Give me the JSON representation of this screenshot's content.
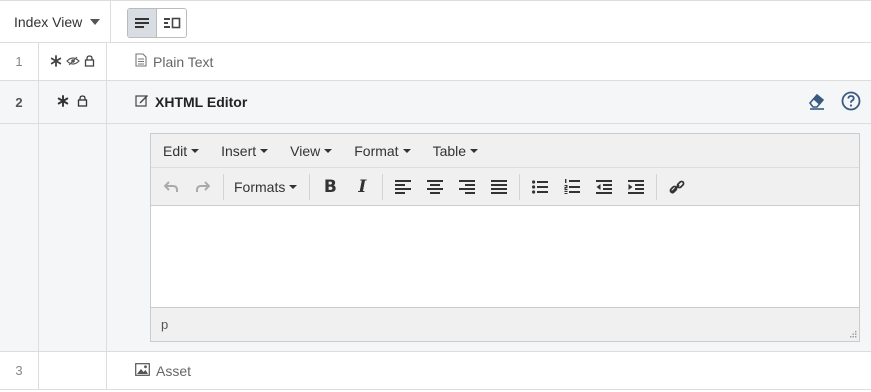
{
  "header": {
    "view_selector_label": "Index View",
    "view_buttons": [
      {
        "icon": "list-view-icon",
        "active": true
      },
      {
        "icon": "detail-view-icon",
        "active": false
      }
    ]
  },
  "rows": [
    {
      "number": "1",
      "flags": [
        "asterisk-icon",
        "eye-icon",
        "lock-icon"
      ],
      "type_icon": "document-icon",
      "label": "Plain Text"
    },
    {
      "number": "2",
      "flags": [
        "asterisk-icon",
        "lock-icon"
      ],
      "type_icon": "edit-icon",
      "label": "XHTML Editor",
      "actions": [
        "eraser-icon",
        "help-icon"
      ]
    },
    {
      "number": "3",
      "flags": [],
      "type_icon": "image-icon",
      "label": "Asset"
    }
  ],
  "editor": {
    "menus": [
      "Edit",
      "Insert",
      "View",
      "Format",
      "Table"
    ],
    "formats_label": "Formats",
    "bold_glyph": "B",
    "italic_glyph": "I",
    "status_path": "p"
  },
  "colors": {
    "border": "#dddddd",
    "selected_row_bg": "#f4f6f8",
    "toolbar_bg": "#f0f0f0",
    "action_icon": "#3a5a80"
  }
}
